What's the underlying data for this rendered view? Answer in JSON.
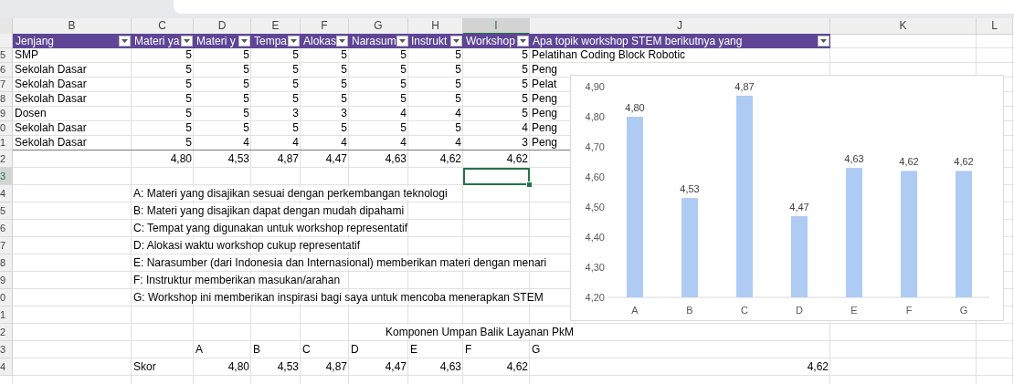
{
  "column_headers": [
    {
      "label": "B",
      "selected": false
    },
    {
      "label": "C",
      "selected": false
    },
    {
      "label": "D",
      "selected": false
    },
    {
      "label": "E",
      "selected": false
    },
    {
      "label": "F",
      "selected": false
    },
    {
      "label": "G",
      "selected": false
    },
    {
      "label": "H",
      "selected": false
    },
    {
      "label": "I",
      "selected": true
    },
    {
      "label": "J",
      "selected": false
    },
    {
      "label": "K",
      "selected": false
    },
    {
      "label": "L",
      "selected": false
    }
  ],
  "rows": [
    {
      "kind": "table-header",
      "cells": [
        {
          "kind": "header",
          "text": "Jenjang"
        },
        {
          "kind": "header",
          "text": "Materi ya"
        },
        {
          "kind": "header",
          "text": "Materi y"
        },
        {
          "kind": "header",
          "text": "Tempa"
        },
        {
          "kind": "header",
          "text": "Alokas"
        },
        {
          "kind": "header",
          "text": "Narasum"
        },
        {
          "kind": "header",
          "text": "Instrukt"
        },
        {
          "kind": "header",
          "text": "Workshop"
        },
        {
          "kind": "header",
          "text": "Apa topik workshop STEM berikutnya yang"
        },
        null,
        null
      ]
    },
    {
      "kind": "table-row",
      "number": "5",
      "cells": [
        {
          "kind": "text",
          "text": "SMP"
        },
        {
          "kind": "number",
          "text": "5"
        },
        {
          "kind": "number",
          "text": "5"
        },
        {
          "kind": "number",
          "text": "5"
        },
        {
          "kind": "number",
          "text": "5"
        },
        {
          "kind": "number",
          "text": "5"
        },
        {
          "kind": "number",
          "text": "5"
        },
        {
          "kind": "number",
          "text": "5"
        },
        {
          "kind": "text",
          "text": "Pelatihan Coding Block Robotic"
        },
        null,
        null
      ]
    },
    {
      "kind": "table-row",
      "number": "6",
      "cells": [
        {
          "kind": "text",
          "text": "Sekolah Dasar"
        },
        {
          "kind": "number",
          "text": "5"
        },
        {
          "kind": "number",
          "text": "5"
        },
        {
          "kind": "number",
          "text": "5"
        },
        {
          "kind": "number",
          "text": "5"
        },
        {
          "kind": "number",
          "text": "5"
        },
        {
          "kind": "number",
          "text": "5"
        },
        {
          "kind": "number",
          "text": "5"
        },
        {
          "kind": "text",
          "text": "Peng"
        },
        null,
        null
      ]
    },
    {
      "kind": "table-row",
      "number": "7",
      "cells": [
        {
          "kind": "text",
          "text": "Sekolah Dasar"
        },
        {
          "kind": "number",
          "text": "5"
        },
        {
          "kind": "number",
          "text": "5"
        },
        {
          "kind": "number",
          "text": "5"
        },
        {
          "kind": "number",
          "text": "5"
        },
        {
          "kind": "number",
          "text": "5"
        },
        {
          "kind": "number",
          "text": "5"
        },
        {
          "kind": "number",
          "text": "5"
        },
        {
          "kind": "text",
          "text": "Pelat"
        },
        null,
        null
      ]
    },
    {
      "kind": "table-row",
      "number": "8",
      "cells": [
        {
          "kind": "text",
          "text": "Sekolah Dasar"
        },
        {
          "kind": "number",
          "text": "5"
        },
        {
          "kind": "number",
          "text": "5"
        },
        {
          "kind": "number",
          "text": "5"
        },
        {
          "kind": "number",
          "text": "5"
        },
        {
          "kind": "number",
          "text": "5"
        },
        {
          "kind": "number",
          "text": "5"
        },
        {
          "kind": "number",
          "text": "5"
        },
        {
          "kind": "text",
          "text": "Peng"
        },
        null,
        null
      ]
    },
    {
      "kind": "table-row",
      "number": "9",
      "cells": [
        {
          "kind": "text",
          "text": "Dosen"
        },
        {
          "kind": "number",
          "text": "5"
        },
        {
          "kind": "number",
          "text": "5"
        },
        {
          "kind": "number",
          "text": "3"
        },
        {
          "kind": "number",
          "text": "3"
        },
        {
          "kind": "number",
          "text": "4"
        },
        {
          "kind": "number",
          "text": "4"
        },
        {
          "kind": "number",
          "text": "5"
        },
        {
          "kind": "text",
          "text": "Peng"
        },
        null,
        null
      ]
    },
    {
      "kind": "table-row",
      "number": "0",
      "cells": [
        {
          "kind": "text",
          "text": "Sekolah Dasar"
        },
        {
          "kind": "number",
          "text": "5"
        },
        {
          "kind": "number",
          "text": "5"
        },
        {
          "kind": "number",
          "text": "5"
        },
        {
          "kind": "number",
          "text": "5"
        },
        {
          "kind": "number",
          "text": "5"
        },
        {
          "kind": "number",
          "text": "5"
        },
        {
          "kind": "number",
          "text": "4"
        },
        {
          "kind": "text",
          "text": "Peng"
        },
        null,
        null
      ]
    },
    {
      "kind": "table-row",
      "number": "1",
      "cells": [
        {
          "kind": "text",
          "text": "Sekolah Dasar"
        },
        {
          "kind": "number",
          "text": "5"
        },
        {
          "kind": "number",
          "text": "4"
        },
        {
          "kind": "number",
          "text": "4"
        },
        {
          "kind": "number",
          "text": "4"
        },
        {
          "kind": "number",
          "text": "4"
        },
        {
          "kind": "number",
          "text": "4"
        },
        {
          "kind": "number",
          "text": "3"
        },
        {
          "kind": "text",
          "text": "Peng"
        },
        null,
        null
      ]
    },
    {
      "kind": "plain",
      "number": "2",
      "cells": [
        null,
        {
          "kind": "number",
          "text": "4,80"
        },
        {
          "kind": "number",
          "text": "4,53"
        },
        {
          "kind": "number",
          "text": "4,87"
        },
        {
          "kind": "number",
          "text": "4,47"
        },
        {
          "kind": "number",
          "text": "4,63"
        },
        {
          "kind": "number",
          "text": "4,62"
        },
        {
          "kind": "number",
          "text": "4,62"
        },
        null,
        null,
        null
      ]
    },
    {
      "kind": "plain",
      "number": "3",
      "selected": true,
      "cells": [
        null,
        null,
        null,
        null,
        null,
        null,
        null,
        null,
        null,
        null,
        null
      ]
    },
    {
      "kind": "plain",
      "number": "4",
      "cells": [
        null,
        {
          "kind": "text",
          "text": "A: Materi yang disajikan sesuai dengan perkembangan teknologi"
        },
        null,
        null,
        null,
        null,
        null,
        null,
        null,
        null,
        null
      ]
    },
    {
      "kind": "plain",
      "number": "5",
      "cells": [
        null,
        {
          "kind": "text",
          "text": "B: Materi yang disajikan dapat dengan mudah dipahami"
        },
        null,
        null,
        null,
        null,
        null,
        null,
        null,
        null,
        null
      ]
    },
    {
      "kind": "plain",
      "number": "6",
      "cells": [
        null,
        {
          "kind": "text",
          "text": "C: Tempat yang digunakan untuk workshop representatif"
        },
        null,
        null,
        null,
        null,
        null,
        null,
        null,
        null,
        null
      ]
    },
    {
      "kind": "plain",
      "number": "7",
      "cells": [
        null,
        {
          "kind": "text",
          "text": "D: Alokasi waktu workshop cukup representatif"
        },
        null,
        null,
        null,
        null,
        null,
        null,
        null,
        null,
        null
      ]
    },
    {
      "kind": "plain",
      "number": "8",
      "cells": [
        null,
        {
          "kind": "text",
          "text": "E: Narasumber (dari Indonesia dan Internasional) memberikan materi dengan menari"
        },
        null,
        null,
        null,
        null,
        null,
        null,
        null,
        null,
        null
      ]
    },
    {
      "kind": "plain",
      "number": "9",
      "cells": [
        null,
        {
          "kind": "text",
          "text": "F: Instruktur memberikan masukan/arahan"
        },
        null,
        null,
        null,
        null,
        null,
        null,
        null,
        null,
        null
      ]
    },
    {
      "kind": "plain",
      "number": "0",
      "cells": [
        null,
        {
          "kind": "text",
          "text": "G: Workshop ini memberikan inspirasi bagi saya untuk mencoba menerapkan STEM"
        },
        null,
        null,
        null,
        null,
        null,
        null,
        null,
        null,
        null
      ]
    },
    {
      "kind": "plain",
      "number": "1",
      "cells": [
        null,
        null,
        null,
        null,
        null,
        null,
        null,
        null,
        null,
        null,
        null
      ]
    },
    {
      "kind": "plain",
      "number": "2",
      "cells": [
        null,
        null,
        null,
        null,
        null,
        {
          "kind": "title",
          "text": "Komponen Umpan Balik Layanan PkM"
        },
        null,
        null,
        null,
        null,
        null
      ]
    },
    {
      "kind": "plain",
      "number": "3",
      "cells": [
        null,
        null,
        {
          "kind": "text",
          "text": "A"
        },
        {
          "kind": "text",
          "text": "B"
        },
        {
          "kind": "text",
          "text": "C"
        },
        {
          "kind": "text",
          "text": "D"
        },
        {
          "kind": "text",
          "text": "E"
        },
        {
          "kind": "text",
          "text": "F"
        },
        {
          "kind": "text",
          "text": "G"
        },
        null,
        null
      ]
    },
    {
      "kind": "plain",
      "number": "4",
      "cells": [
        null,
        {
          "kind": "text",
          "text": "Skor"
        },
        {
          "kind": "number",
          "text": "4,80"
        },
        {
          "kind": "number",
          "text": "4,53"
        },
        {
          "kind": "number",
          "text": "4,87"
        },
        {
          "kind": "number",
          "text": "4,47"
        },
        {
          "kind": "number",
          "text": "4,63"
        },
        {
          "kind": "number",
          "text": "4,62"
        },
        {
          "kind": "number",
          "text": "4,62"
        },
        null,
        null
      ]
    }
  ],
  "chart": {
    "chart_data": {
      "type": "bar",
      "categories": [
        "A",
        "B",
        "C",
        "D",
        "E",
        "F",
        "G"
      ],
      "series": [
        {
          "color": "#aecbf4",
          "values": [
            4.8,
            4.53,
            4.87,
            4.47,
            4.63,
            4.62,
            4.62
          ]
        }
      ],
      "ylim": [
        4.2,
        4.9
      ],
      "yticks": [
        {
          "value": 4.2,
          "label": "4,20"
        },
        {
          "value": 4.3,
          "label": "4,30"
        },
        {
          "value": 4.4,
          "label": "4,40"
        },
        {
          "value": 4.5,
          "label": "4,50"
        },
        {
          "value": 4.6,
          "label": "4,60"
        },
        {
          "value": 4.7,
          "label": "4,70"
        },
        {
          "value": 4.8,
          "label": "4,80"
        },
        {
          "value": 4.9,
          "label": "4,90"
        }
      ],
      "value_labels": [
        "4,80",
        "4,53",
        "4,87",
        "4,47",
        "4,63",
        "4,62",
        "4,62"
      ]
    }
  }
}
